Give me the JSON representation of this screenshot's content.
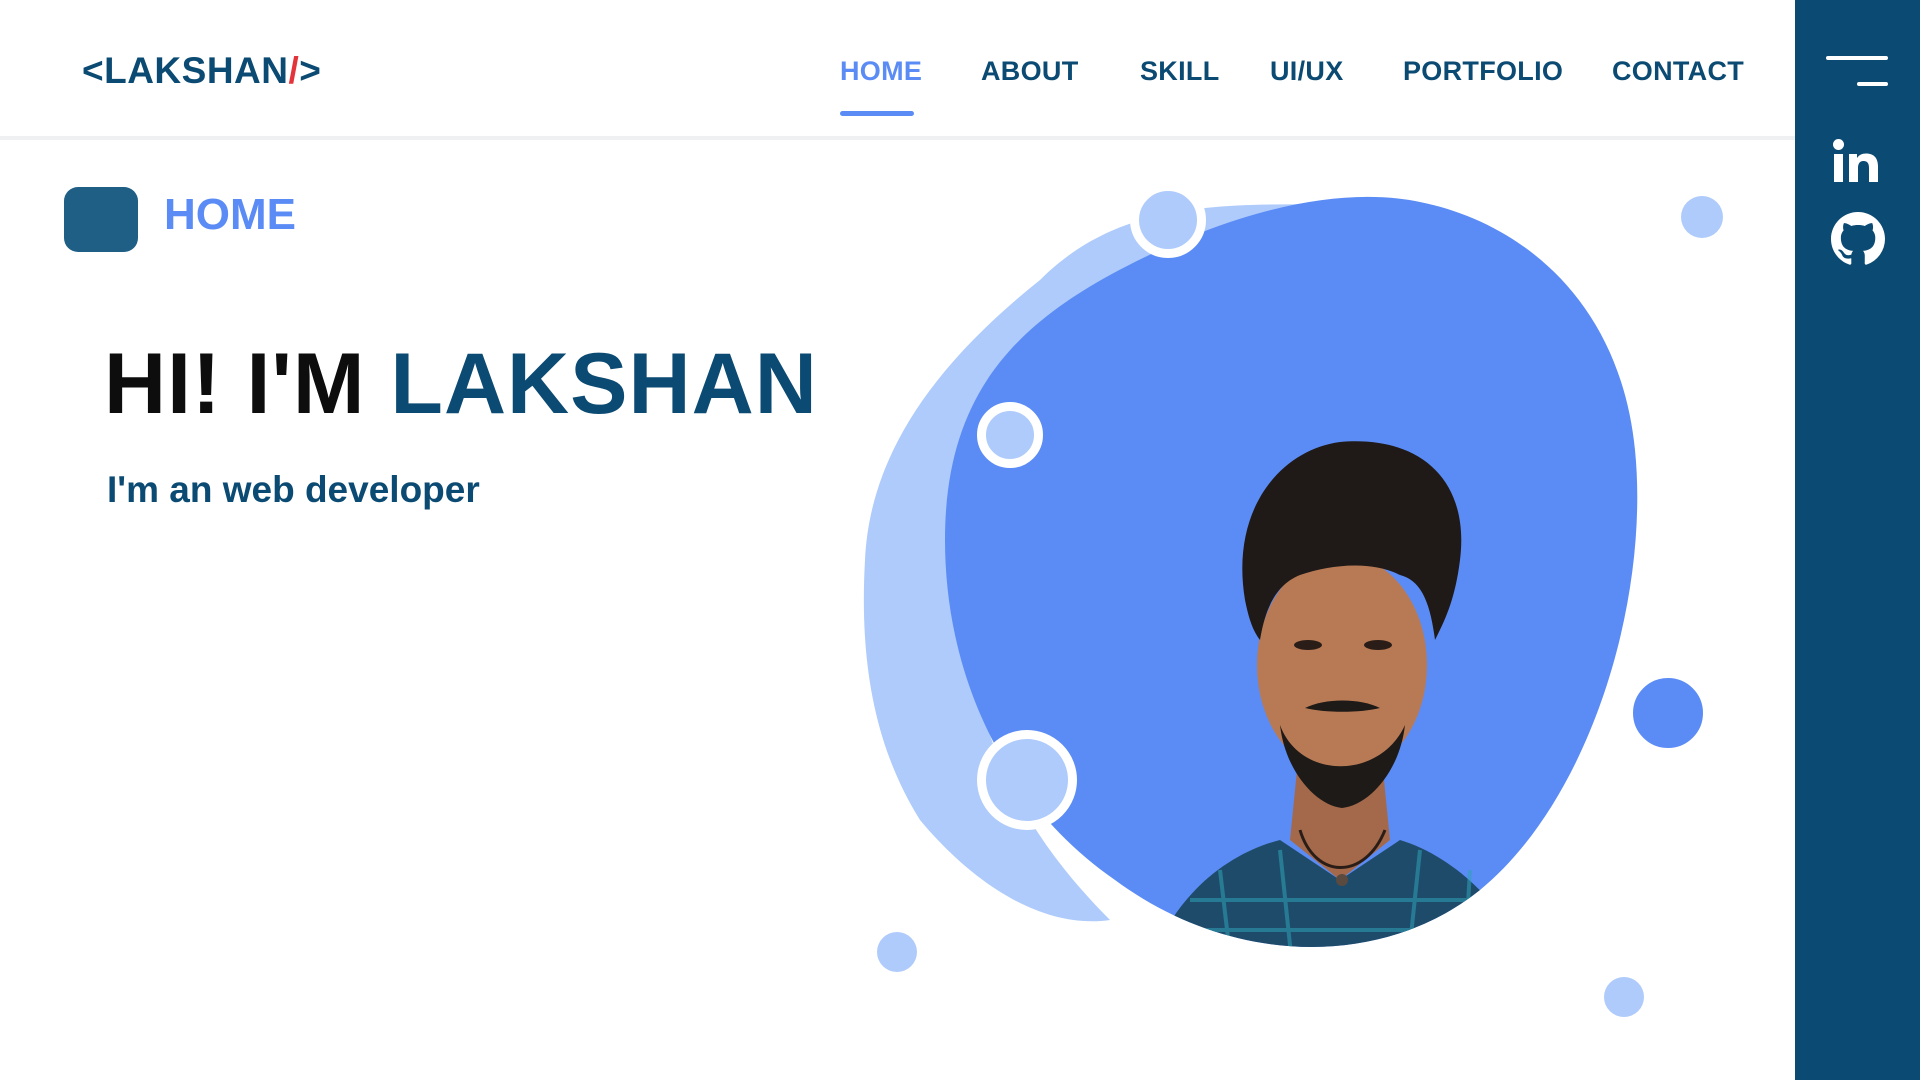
{
  "logo": {
    "open": "<LAKSHAN",
    "slash": "/",
    "close": ">"
  },
  "nav": {
    "items": [
      {
        "label": "HOME",
        "active": true
      },
      {
        "label": "ABOUT",
        "active": false
      },
      {
        "label": "SKILL",
        "active": false
      },
      {
        "label": "UI/UX",
        "active": false
      },
      {
        "label": "PORTFOLIO",
        "active": false
      },
      {
        "label": "CONTACT",
        "active": false
      }
    ]
  },
  "sidebar": {
    "icons": [
      "menu-icon",
      "linkedin-icon",
      "github-icon"
    ]
  },
  "section": {
    "title": "HOME"
  },
  "hero": {
    "greeting": "HI! I'M",
    "name": "LAKSHAN",
    "subtitle": "I'm an web developer",
    "photo_alt": "portrait photo"
  },
  "colors": {
    "navy": "#0b4a72",
    "accent_blue": "#5b8cf5",
    "light_blue": "#aecbfb",
    "logo_slash": "#e3343b",
    "section_box": "#1f5f86"
  }
}
